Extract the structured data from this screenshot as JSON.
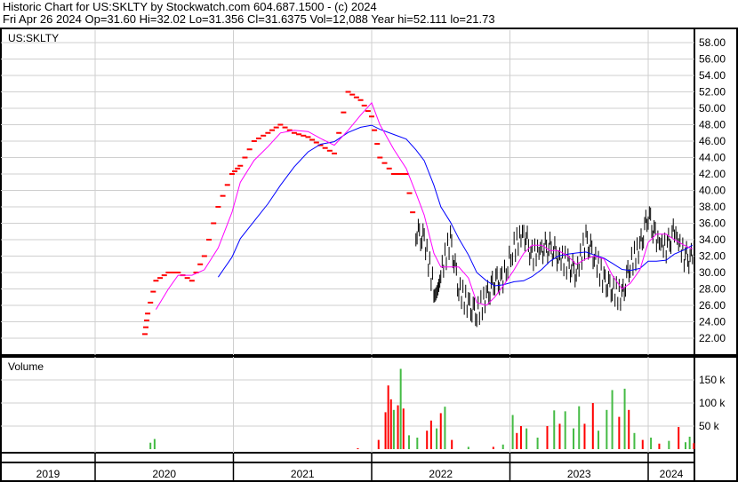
{
  "header": {
    "title": "Historic Chart for US:SKLTY by Stockwatch.com 604.687.1500 - (c) 2024",
    "quote": "Fri Apr 26 2024   Op=31.60  Hi=32.02  Lo=31.356  Cl=31.6375  Vol=12,088   Year hi=52.111  lo=21.73"
  },
  "chart_data": {
    "type": "line",
    "symbol_label": "US:SKLTY",
    "volume_label": "Volume",
    "y_ticks": [
      "22.00",
      "24.00",
      "26.00",
      "28.00",
      "30.00",
      "32.00",
      "34.00",
      "36.00",
      "38.00",
      "40.00",
      "42.00",
      "44.00",
      "46.00",
      "48.00",
      "50.00",
      "52.00",
      "54.00",
      "56.00",
      "58.00"
    ],
    "ylim": [
      20.5,
      59.5
    ],
    "volume_ticks": [
      {
        "v": 50000,
        "label": "50 k"
      },
      {
        "v": 100000,
        "label": "100 k"
      },
      {
        "v": 150000,
        "label": "150 k"
      }
    ],
    "x_years": [
      "2019",
      "2020",
      "2021",
      "2022",
      "2023",
      "2024"
    ],
    "xlim": [
      2019.31,
      2024.35
    ],
    "ma_windows": {
      "short": 3,
      "long": 8
    },
    "colors": {
      "short_ma": "#ff00ff",
      "long_ma": "#0000ff",
      "up": "#44bb44",
      "down": "#ff0000",
      "price_early": "#ff0000",
      "price_late": "#000000"
    },
    "close": [
      [
        2020.36,
        22.5
      ],
      [
        2020.38,
        25
      ],
      [
        2020.44,
        29
      ],
      [
        2020.53,
        30
      ],
      [
        2020.6,
        30
      ],
      [
        2020.7,
        29
      ],
      [
        2020.79,
        32
      ],
      [
        2020.89,
        38
      ],
      [
        2020.99,
        42
      ],
      [
        2021.05,
        43
      ],
      [
        2021.15,
        46
      ],
      [
        2021.25,
        47
      ],
      [
        2021.34,
        48
      ],
      [
        2021.44,
        47
      ],
      [
        2021.54,
        46.5
      ],
      [
        2021.63,
        45.5
      ],
      [
        2021.73,
        44.5
      ],
      [
        2021.83,
        52
      ],
      [
        2021.92,
        51
      ],
      [
        2022.0,
        49
      ],
      [
        2022.06,
        44
      ],
      [
        2022.16,
        42
      ],
      [
        2022.25,
        42
      ],
      [
        2022.32,
        35
      ],
      [
        2022.38,
        34
      ],
      [
        2022.45,
        28
      ],
      [
        2022.5,
        30
      ],
      [
        2022.57,
        34
      ],
      [
        2022.63,
        28
      ],
      [
        2022.7,
        26
      ],
      [
        2022.76,
        25
      ],
      [
        2022.83,
        27
      ],
      [
        2022.89,
        29
      ],
      [
        2022.95,
        29
      ],
      [
        2023.03,
        33
      ],
      [
        2023.1,
        35
      ],
      [
        2023.16,
        32
      ],
      [
        2023.23,
        33
      ],
      [
        2023.29,
        33
      ],
      [
        2023.35,
        32
      ],
      [
        2023.42,
        31
      ],
      [
        2023.48,
        30
      ],
      [
        2023.55,
        34
      ],
      [
        2023.61,
        32
      ],
      [
        2023.68,
        29
      ],
      [
        2023.74,
        28
      ],
      [
        2023.81,
        27
      ],
      [
        2023.87,
        31
      ],
      [
        2023.94,
        33
      ],
      [
        2024.0,
        37
      ],
      [
        2024.06,
        34
      ],
      [
        2024.13,
        33
      ],
      [
        2024.19,
        35
      ],
      [
        2024.26,
        32
      ],
      [
        2024.32,
        31.6
      ]
    ],
    "volume": [
      [
        2020.4,
        14000,
        "g"
      ],
      [
        2020.43,
        22000,
        "g"
      ],
      [
        2021.9,
        2000,
        "r"
      ],
      [
        2022.05,
        20000,
        "r"
      ],
      [
        2022.1,
        80000,
        "r"
      ],
      [
        2022.12,
        138000,
        "r"
      ],
      [
        2022.14,
        108000,
        "r"
      ],
      [
        2022.16,
        85000,
        "g"
      ],
      [
        2022.19,
        95000,
        "r"
      ],
      [
        2022.21,
        174000,
        "g"
      ],
      [
        2022.23,
        88000,
        "r"
      ],
      [
        2022.27,
        30000,
        "g"
      ],
      [
        2022.33,
        25000,
        "g"
      ],
      [
        2022.4,
        40000,
        "r"
      ],
      [
        2022.43,
        62000,
        "r"
      ],
      [
        2022.47,
        45000,
        "g"
      ],
      [
        2022.5,
        78000,
        "r"
      ],
      [
        2022.53,
        92000,
        "g"
      ],
      [
        2022.58,
        20000,
        "r"
      ],
      [
        2022.7,
        5000,
        "g"
      ],
      [
        2022.88,
        5000,
        "r"
      ],
      [
        2022.95,
        10000,
        "g"
      ],
      [
        2023.02,
        74000,
        "g"
      ],
      [
        2023.05,
        35000,
        "r"
      ],
      [
        2023.08,
        50000,
        "r"
      ],
      [
        2023.12,
        45000,
        "g"
      ],
      [
        2023.2,
        25000,
        "g"
      ],
      [
        2023.27,
        50000,
        "r"
      ],
      [
        2023.32,
        84000,
        "g"
      ],
      [
        2023.36,
        55000,
        "r"
      ],
      [
        2023.4,
        82000,
        "g"
      ],
      [
        2023.46,
        45000,
        "g"
      ],
      [
        2023.5,
        93000,
        "g"
      ],
      [
        2023.54,
        55000,
        "r"
      ],
      [
        2023.6,
        100000,
        "r"
      ],
      [
        2023.64,
        40000,
        "g"
      ],
      [
        2023.7,
        85000,
        "g"
      ],
      [
        2023.74,
        128000,
        "g"
      ],
      [
        2023.79,
        70000,
        "r"
      ],
      [
        2023.83,
        131000,
        "g"
      ],
      [
        2023.86,
        85000,
        "r"
      ],
      [
        2023.9,
        35000,
        "g"
      ],
      [
        2023.96,
        20000,
        "r"
      ],
      [
        2024.02,
        25000,
        "g"
      ],
      [
        2024.08,
        12000,
        "r"
      ],
      [
        2024.15,
        18000,
        "g"
      ],
      [
        2024.22,
        48000,
        "r"
      ],
      [
        2024.27,
        15000,
        "g"
      ],
      [
        2024.3,
        27000,
        "g"
      ],
      [
        2024.33,
        13000,
        "r"
      ]
    ]
  }
}
